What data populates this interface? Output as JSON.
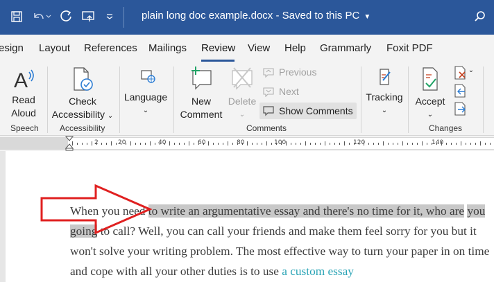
{
  "titlebar": {
    "doc_name": "plain long doc example.docx",
    "separator": " - ",
    "save_status": "Saved to this PC",
    "icons": [
      "save-icon",
      "undo-icon",
      "redo-icon",
      "touch-mode-icon",
      "customize-qat-icon",
      "search-icon"
    ]
  },
  "tabs": [
    "esign",
    "Layout",
    "References",
    "Mailings",
    "Review",
    "View",
    "Help",
    "Grammarly",
    "Foxit PDF"
  ],
  "active_tab": "Review",
  "ribbon": {
    "read_aloud": [
      "Read",
      "Aloud"
    ],
    "speech_group": "Speech",
    "check_accessibility": [
      "Check",
      "Accessibility"
    ],
    "accessibility_group": "Accessibility",
    "language": "Language",
    "new_comment": [
      "New",
      "Comment"
    ],
    "delete": "Delete",
    "previous": "Previous",
    "next": "Next",
    "show_comments": "Show Comments",
    "comments_group": "Comments",
    "tracking": "Tracking",
    "accept": "Accept",
    "changes_group": "Changes"
  },
  "ruler": {
    "numbers": [
      "2",
      "20",
      "40",
      "60",
      "80",
      "100",
      "120",
      "140"
    ]
  },
  "document": {
    "before_highlight": "When you need ",
    "highlight_1": "to write an argumentative essay and there's no time for it, who are",
    "highlight_2": "you going",
    "after_highlight": " to call? Well, you can call your friends and make them feel sorry for you but it won't solve your writing problem. The most effective way to turn your paper in on time and cope with all your other duties is to use ",
    "link_text": "a custom essay"
  },
  "colors": {
    "title_bar": "#2b579a",
    "ribbon_bg": "#f3f3f3",
    "highlight": "#c8c8c8",
    "arrow": "#e02020",
    "link": "#2aa4b6"
  }
}
